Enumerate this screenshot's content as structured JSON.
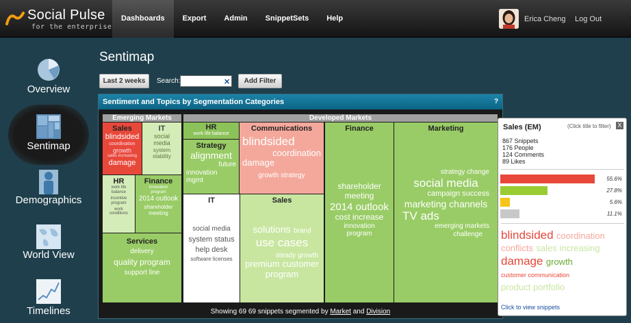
{
  "brand": {
    "name": "Social Pulse",
    "tagline": "for the enterprise"
  },
  "nav": [
    {
      "label": "Dashboards",
      "active": true
    },
    {
      "label": "Export"
    },
    {
      "label": "Admin"
    },
    {
      "label": "SnippetSets"
    },
    {
      "label": "Help"
    }
  ],
  "user": {
    "name": "Erica Cheng",
    "logout": "Log Out"
  },
  "sidebar": [
    {
      "label": "Overview",
      "icon": "pie-chart-icon"
    },
    {
      "label": "Sentimap",
      "icon": "treemap-icon",
      "active": true
    },
    {
      "label": "Demographics",
      "icon": "person-icon"
    },
    {
      "label": "World View",
      "icon": "globe-icon"
    },
    {
      "label": "Timelines",
      "icon": "line-chart-icon"
    }
  ],
  "page": {
    "title": "Sentimap",
    "range_button": "Last 2 weeks",
    "search_label": "Search:",
    "search_value": "",
    "clear_icon": "close-icon",
    "add_filter": "Add Filter"
  },
  "panel": {
    "title": "Sentiment and Topics by Segmentation Categories",
    "help": "?",
    "segments": [
      "Emerging Markets",
      "Developed Markets"
    ],
    "footer": {
      "prefix": "Showing 69 69 snippets segmented by",
      "link1": "Market",
      "and": "and",
      "link2": "Division"
    }
  },
  "colors": {
    "red": "#e8483a",
    "pink": "#f4a89c",
    "green": "#99cc66",
    "lightgreen": "#c8e6a0",
    "midgreen": "#8cc25a",
    "white": "#ffffff"
  },
  "cells": {
    "em_sales": {
      "title": "Sales",
      "words": [
        "blindsided",
        "coordination",
        "growth",
        "sales increasing",
        "damage"
      ]
    },
    "em_it": {
      "title": "IT",
      "words": [
        "social",
        "media",
        "system",
        "stability"
      ]
    },
    "em_hr": {
      "title": "HR",
      "words": [
        "work life",
        "balance",
        "incentive",
        "program",
        "work",
        "conditions"
      ]
    },
    "em_fin": {
      "title": "Finance",
      "words": [
        "innovation",
        "program",
        "2014 outlook",
        "shareholder",
        "meeting"
      ]
    },
    "em_svc": {
      "title": "Services",
      "words": [
        "delivery",
        "quality program",
        "support line"
      ]
    },
    "dm_hr": {
      "title": "HR",
      "words": [
        "work life balance"
      ]
    },
    "dm_strat": {
      "title": "Strategy",
      "words": [
        "alignment",
        "future",
        "innovation",
        "mgmt"
      ]
    },
    "dm_comm": {
      "title": "Communications",
      "words": [
        "blindsided",
        "coordination",
        "damage",
        "growth strategy"
      ]
    },
    "dm_fin": {
      "title": "Finance",
      "words": [
        "shareholder",
        "meeting",
        "2014 outlook",
        "cost increase",
        "innovation",
        "program"
      ]
    },
    "dm_mkt": {
      "title": "Marketing",
      "words": [
        "strategy change",
        "social media",
        "campaign success",
        "marketing channels",
        "TV ads",
        "emerging markets",
        "challenge"
      ]
    },
    "dm_it": {
      "title": "IT",
      "words": [
        "social media",
        "system status",
        "help desk",
        "software licenses"
      ]
    },
    "dm_sales": {
      "title": "Sales",
      "words": [
        "solutions",
        "brand",
        "use cases",
        "steady growth",
        "premium customer",
        "program"
      ]
    }
  },
  "popup": {
    "title": "Sales (EM)",
    "hint": "(Click title to filter)",
    "close": "X",
    "stats": [
      "867 Snippets",
      "176 People",
      "124 Comments",
      "89 Likes"
    ],
    "bars": [
      {
        "color": "#e8483a",
        "pct": "55.6%",
        "value": 0.556
      },
      {
        "color": "#99cc33",
        "pct": "27.8%",
        "value": 0.278
      },
      {
        "color": "#f5c518",
        "pct": "5.6%",
        "value": 0.056
      },
      {
        "color": "#c8c8c8",
        "pct": "11.1%",
        "value": 0.111
      }
    ],
    "cloud": [
      "blindsided",
      "coordination",
      "conflicts",
      "sales increasing",
      "damage",
      "growth",
      "customer communication",
      "product portfolio"
    ],
    "link": "Click to view snippets"
  }
}
